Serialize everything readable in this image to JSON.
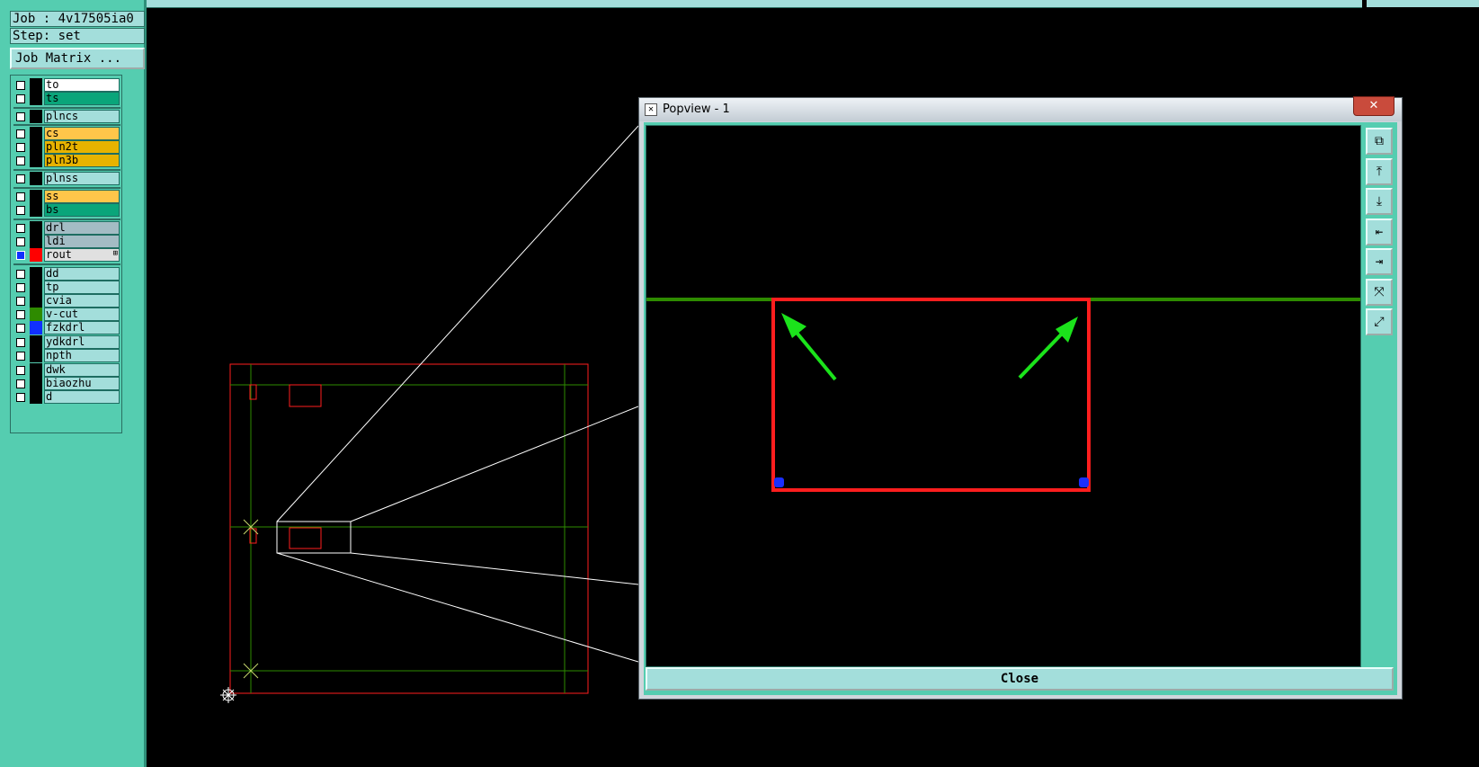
{
  "left_panel": {
    "job": "Job : 4v17505ia0",
    "step": "Step: set",
    "job_matrix_label": "Job Matrix ...",
    "layers": [
      {
        "name": "to",
        "color": "#ffffff",
        "swatch": "#000000"
      },
      {
        "name": "ts",
        "color": "#0aa57a",
        "swatch": "#000000"
      },
      {
        "name": "plncs",
        "color": "#a3dedb",
        "swatch": "#000000"
      },
      {
        "name": "cs",
        "color": "#ffc64a",
        "swatch": "#000000"
      },
      {
        "name": "pln2t",
        "color": "#e7b300",
        "swatch": "#000000"
      },
      {
        "name": "pln3b",
        "color": "#e7b300",
        "swatch": "#000000"
      },
      {
        "name": "plnss",
        "color": "#a3dedb",
        "swatch": "#000000"
      },
      {
        "name": "ss",
        "color": "#ffc64a",
        "swatch": "#000000"
      },
      {
        "name": "bs",
        "color": "#0aa57a",
        "swatch": "#000000"
      },
      {
        "name": "drl",
        "color": "#a3bcc4",
        "swatch": "#000000"
      },
      {
        "name": "ldi",
        "color": "#a3bcc4",
        "swatch": "#000000"
      },
      {
        "name": "rout",
        "color": "#e0e0e0",
        "swatch": "#ff0000",
        "checked": true,
        "mark": "⊞"
      },
      {
        "name": "dd",
        "color": "#a3dedb",
        "swatch": "#000000"
      },
      {
        "name": "tp",
        "color": "#a3dedb",
        "swatch": "#000000"
      },
      {
        "name": "cvia",
        "color": "#a3dedb",
        "swatch": "#000000"
      },
      {
        "name": "v-cut",
        "color": "#a3dedb",
        "swatch": "#2e8b00"
      },
      {
        "name": "fzkdrl",
        "color": "#a3dedb",
        "swatch": "#1030ff"
      },
      {
        "name": "ydkdrl",
        "color": "#a3dedb",
        "swatch": "#000000"
      },
      {
        "name": "npth",
        "color": "#a3dedb",
        "swatch": "#000000"
      },
      {
        "name": "dwk",
        "color": "#a3dedb",
        "swatch": "#000000"
      },
      {
        "name": "biaozhu",
        "color": "#a3dedb",
        "swatch": "#000000"
      },
      {
        "name": "d",
        "color": "#a3dedb",
        "swatch": "#000000"
      }
    ]
  },
  "popview": {
    "title": "Popview - 1",
    "close_x": "✕",
    "close_button": "Close",
    "tools": [
      "zoom-fit-icon",
      "pan-up-icon",
      "pan-down-icon",
      "pan-left-icon",
      "pan-right-icon",
      "zoom-in-icon",
      "zoom-out-icon"
    ]
  },
  "colors": {
    "rout": "#ff1e1e",
    "vcut": "#2e8b00",
    "highlight": "#c98a00",
    "pad": "#1a2fff",
    "arrow": "#1be31b"
  }
}
